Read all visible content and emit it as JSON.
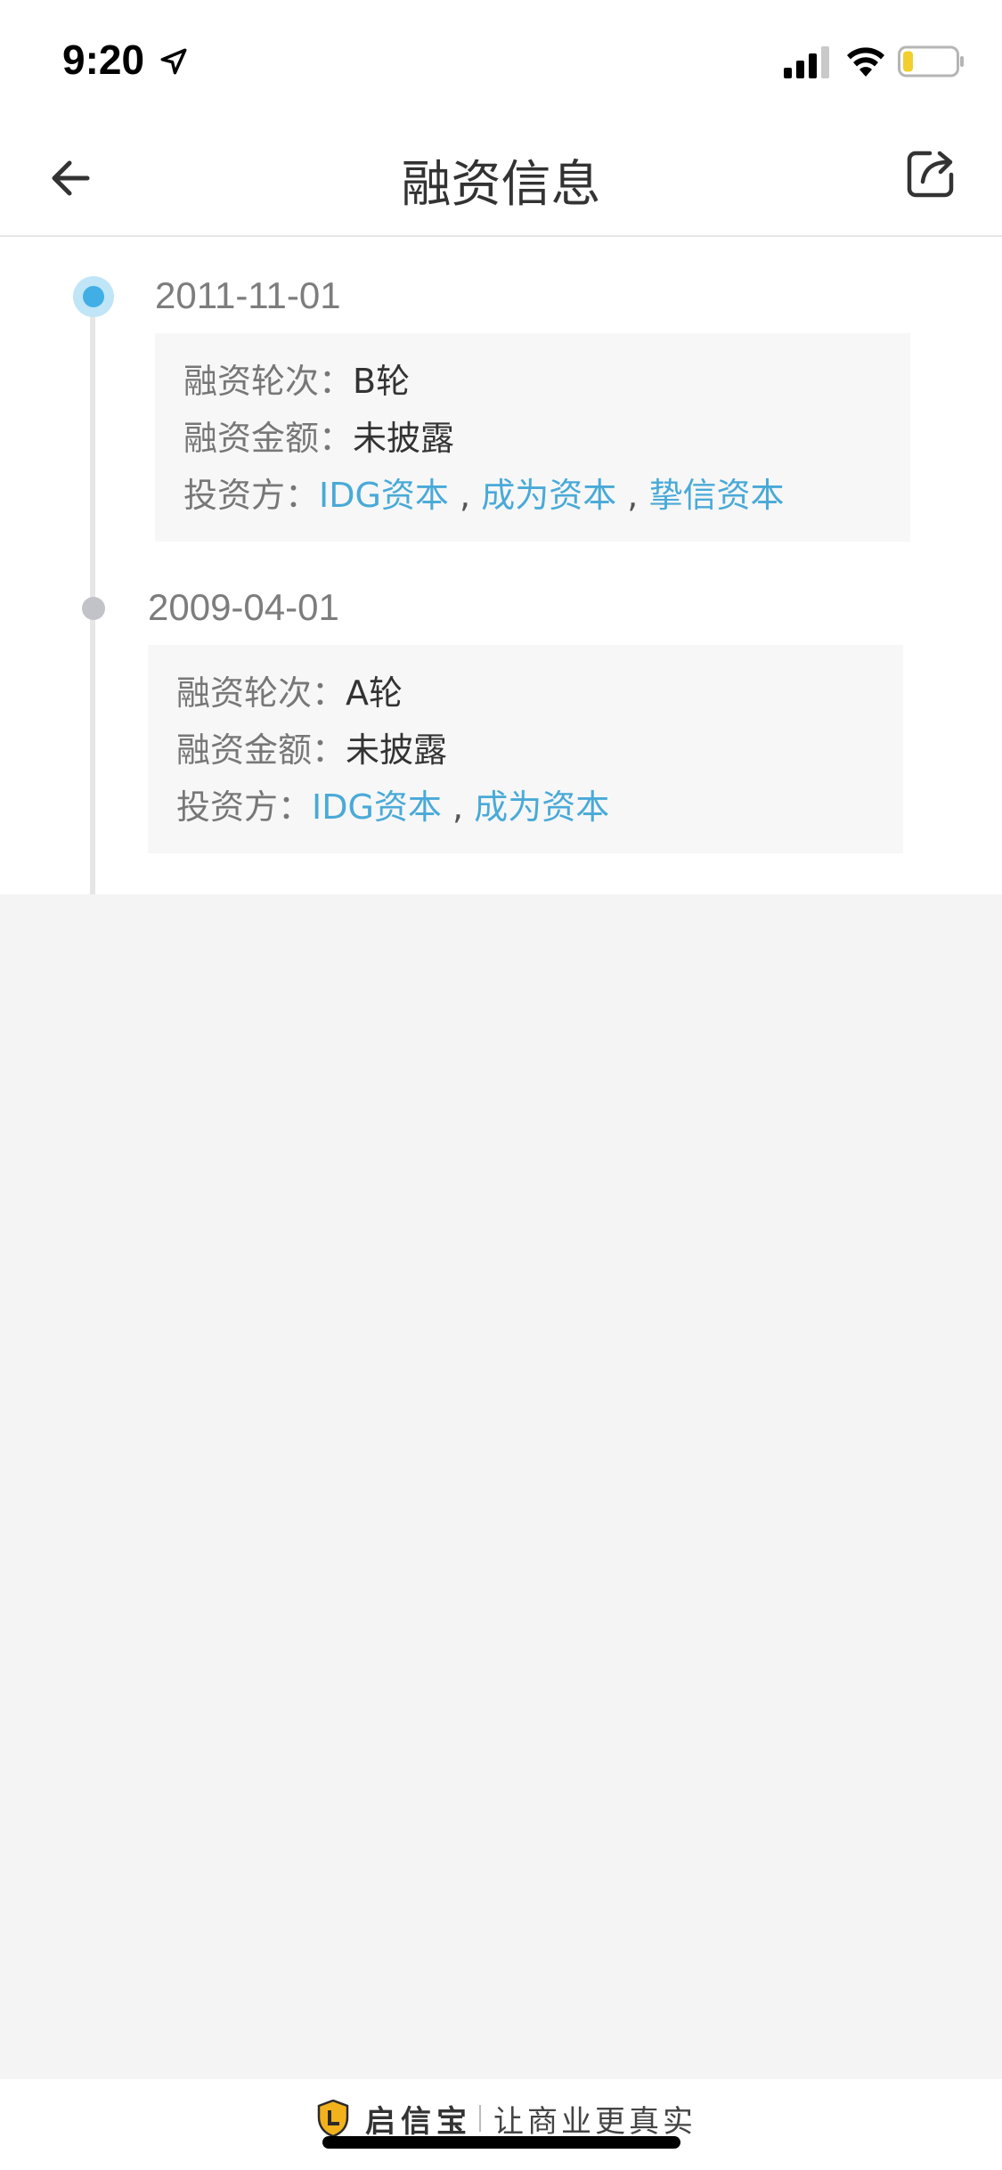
{
  "status": {
    "time": "9:20"
  },
  "nav": {
    "title": "融资信息"
  },
  "timeline": [
    {
      "date": "2011-11-01",
      "round_label": "融资轮次：",
      "round_value": "B轮",
      "amount_label": "融资金额：",
      "amount_value": "未披露",
      "investor_label": "投资方：",
      "investors": [
        "IDG资本",
        "成为资本",
        "挚信资本"
      ]
    },
    {
      "date": "2009-04-01",
      "round_label": "融资轮次：",
      "round_value": "A轮",
      "amount_label": "融资金额：",
      "amount_value": "未披露",
      "investor_label": "投资方：",
      "investors": [
        "IDG资本",
        "成为资本"
      ]
    }
  ],
  "separator": " , ",
  "footer": {
    "brand": "启信宝",
    "slogan": "让商业更真实"
  },
  "colors": {
    "accent": "#41aee6",
    "link": "#49aad8",
    "inactive_dot": "#c2c3c8",
    "card_bg": "#f7f7f7"
  },
  "icons": [
    "location-arrow-icon",
    "signal-icon",
    "wifi-icon",
    "battery-icon",
    "back-arrow-icon",
    "share-icon",
    "shield-logo-icon"
  ]
}
